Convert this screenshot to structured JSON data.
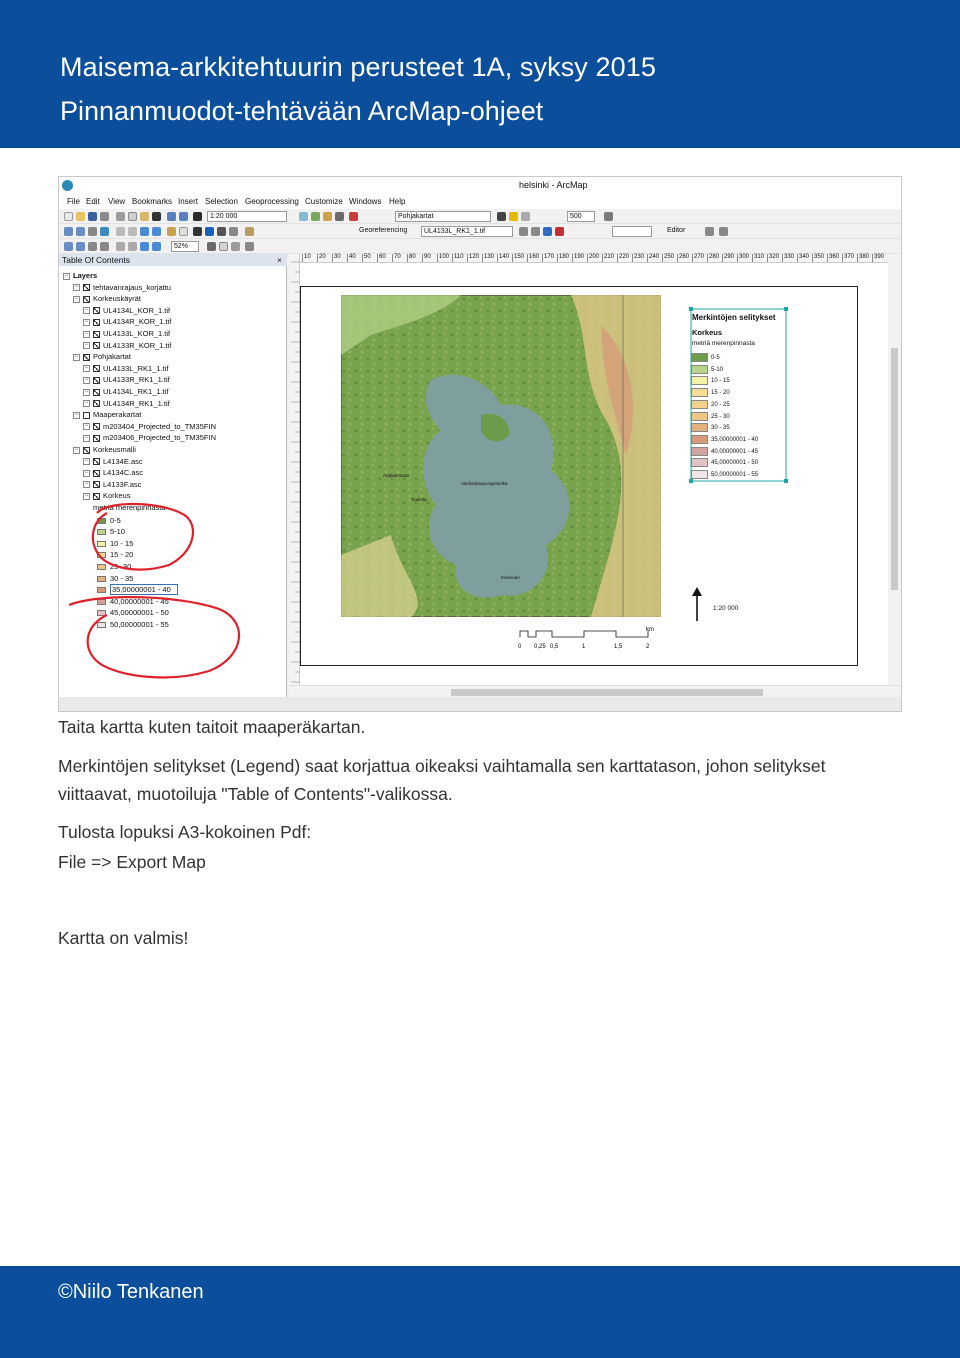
{
  "header": {
    "title_line1": "Maisema-arkkitehtuurin perusteet 1A, syksy 2015",
    "title_line2": "Pinnanmuodot-tehtävään ArcMap-ohjeet"
  },
  "arcmap": {
    "window_title": "helsinki - ArcMap",
    "menu": [
      "File",
      "Edit",
      "View",
      "Bookmarks",
      "Insert",
      "Selection",
      "Geoprocessing",
      "Customize",
      "Windows",
      "Help"
    ],
    "scale_value": "1:20 000",
    "basemap_value": "Pohjakartat",
    "zoom_value": "500",
    "georef_label": "Georeferencing",
    "georef_layer": "UL4133L_RK1_1.tif",
    "editor_label": "Editor",
    "zoom_percent": "52%",
    "toc": {
      "title": "Table Of Contents",
      "close": "×",
      "rows": [
        {
          "text": "Layers",
          "level": 0,
          "bold": true
        },
        {
          "text": "tehtavanrajaus_korjattu",
          "level": 1,
          "check": true
        },
        {
          "text": "Korkeuskäyrät",
          "level": 1,
          "check": true
        },
        {
          "text": "UL4134L_KOR_1.tif",
          "level": 2,
          "check": true
        },
        {
          "text": "UL4134R_KOR_1.tif",
          "level": 2,
          "check": true
        },
        {
          "text": "UL4133L_KOR_1.tif",
          "level": 2,
          "check": true
        },
        {
          "text": "UL4133R_KOR_1.tif",
          "level": 2,
          "check": true
        },
        {
          "text": "Pohjakartat",
          "level": 1,
          "check": true
        },
        {
          "text": "UL4133L_RK1_1.tif",
          "level": 2,
          "check": true
        },
        {
          "text": "UL4133R_RK1_1.tif",
          "level": 2,
          "check": true
        },
        {
          "text": "UL4134L_RK1_1.tif",
          "level": 2,
          "check": true
        },
        {
          "text": "UL4134R_RK1_1.tif",
          "level": 2,
          "check": true
        },
        {
          "text": "Maaperakartat",
          "level": 1,
          "check": false
        },
        {
          "text": "m203404_Projected_to_TM35FIN",
          "level": 2,
          "check": true
        },
        {
          "text": "m203406_Projected_to_TM35FIN",
          "level": 2,
          "check": true
        },
        {
          "text": "Korkeusmalli",
          "level": 1,
          "check": true
        },
        {
          "text": "L4134E.asc",
          "level": 2,
          "check": true
        },
        {
          "text": "L4134C.asc",
          "level": 2,
          "check": true
        },
        {
          "text": "L4133F.asc",
          "level": 2,
          "check": true
        },
        {
          "text": "Korkeus",
          "level": 2,
          "check": true
        },
        {
          "text": "metriä merenpinnasta",
          "level": 3
        }
      ],
      "classes": [
        {
          "label": "0-5",
          "color": "#6d9a4b"
        },
        {
          "label": "5-10",
          "color": "#b9d48c"
        },
        {
          "label": "10 - 15",
          "color": "#f3f0a8"
        },
        {
          "label": "15 - 20",
          "color": "#f5dc94"
        },
        {
          "label": "25- 30",
          "color": "#edc688"
        },
        {
          "label": "30 - 35",
          "color": "#e4b07e"
        },
        {
          "label": "35,00000001 - 40",
          "color": "#d69a78",
          "selected": true
        },
        {
          "label": "40,00000001 - 45",
          "color": "#d3a3a0"
        },
        {
          "label": "45,00000001 - 50",
          "color": "#e0c4c4"
        },
        {
          "label": "50,00000001 - 55",
          "color": "#f0e6e6"
        }
      ]
    },
    "ruler_top": [
      "10",
      "20",
      "30",
      "40",
      "50",
      "60",
      "70",
      "80",
      "90",
      "100",
      "110",
      "120",
      "130",
      "140",
      "150",
      "160",
      "170",
      "180",
      "190",
      "200",
      "210",
      "220",
      "230",
      "240",
      "250",
      "260",
      "270",
      "280",
      "290",
      "300",
      "310",
      "320",
      "330",
      "340",
      "350",
      "360",
      "370",
      "380",
      "390"
    ],
    "legend": {
      "heading": "Merkintöjen selitykset",
      "subtitle": "Korkeus",
      "unit": "metriä merenpinnasta",
      "items": [
        {
          "label": "0-5",
          "color": "#6d9a4b"
        },
        {
          "label": "5-10",
          "color": "#b9d48c"
        },
        {
          "label": "10 - 15",
          "color": "#f3f0a8"
        },
        {
          "label": "15 - 20",
          "color": "#f5dc94"
        },
        {
          "label": "20 - 25",
          "color": "#f2d08e"
        },
        {
          "label": "25 - 30",
          "color": "#edc688"
        },
        {
          "label": "30 - 35",
          "color": "#e4b07e"
        },
        {
          "label": "35,00000001 - 40",
          "color": "#d69a78"
        },
        {
          "label": "40,00000001 - 45",
          "color": "#d3a3a0"
        },
        {
          "label": "45,00000001 - 50",
          "color": "#e0c4c4"
        },
        {
          "label": "50,00000001 - 55",
          "color": "#f0e6e6"
        }
      ]
    },
    "scalebar_unit": "km",
    "scalebar_ticks": [
      "0",
      "0,25",
      "0,5",
      "1",
      "1,5",
      "2"
    ],
    "scale_text": "1:20 000",
    "map_labels": [
      "Arabianranta",
      "Toukola",
      "Vanhankaupunginselkä",
      "Kulosaari"
    ],
    "colors": {
      "header_bg": "#0b4f9c",
      "annotation_red": "#e0202a",
      "selection": "#1fa5a5"
    }
  },
  "body": {
    "p1": "Taita kartta kuten taitoit maaperäkartan.",
    "p2_line1": "Merkintöjen selitykset (Legend) saat korjattua oikeaksi vaihtamalla sen karttatason, johon selitykset",
    "p2_line2": "viittaavat, muotoiluja \"Table of Contents\"-valikossa.",
    "p3_line1": "Tulosta lopuksi A3-kokoinen Pdf:",
    "p3_line2": "File => Export Map",
    "p4": "Kartta on valmis!"
  },
  "footer": {
    "copyright": "©Niilo Tenkanen"
  }
}
